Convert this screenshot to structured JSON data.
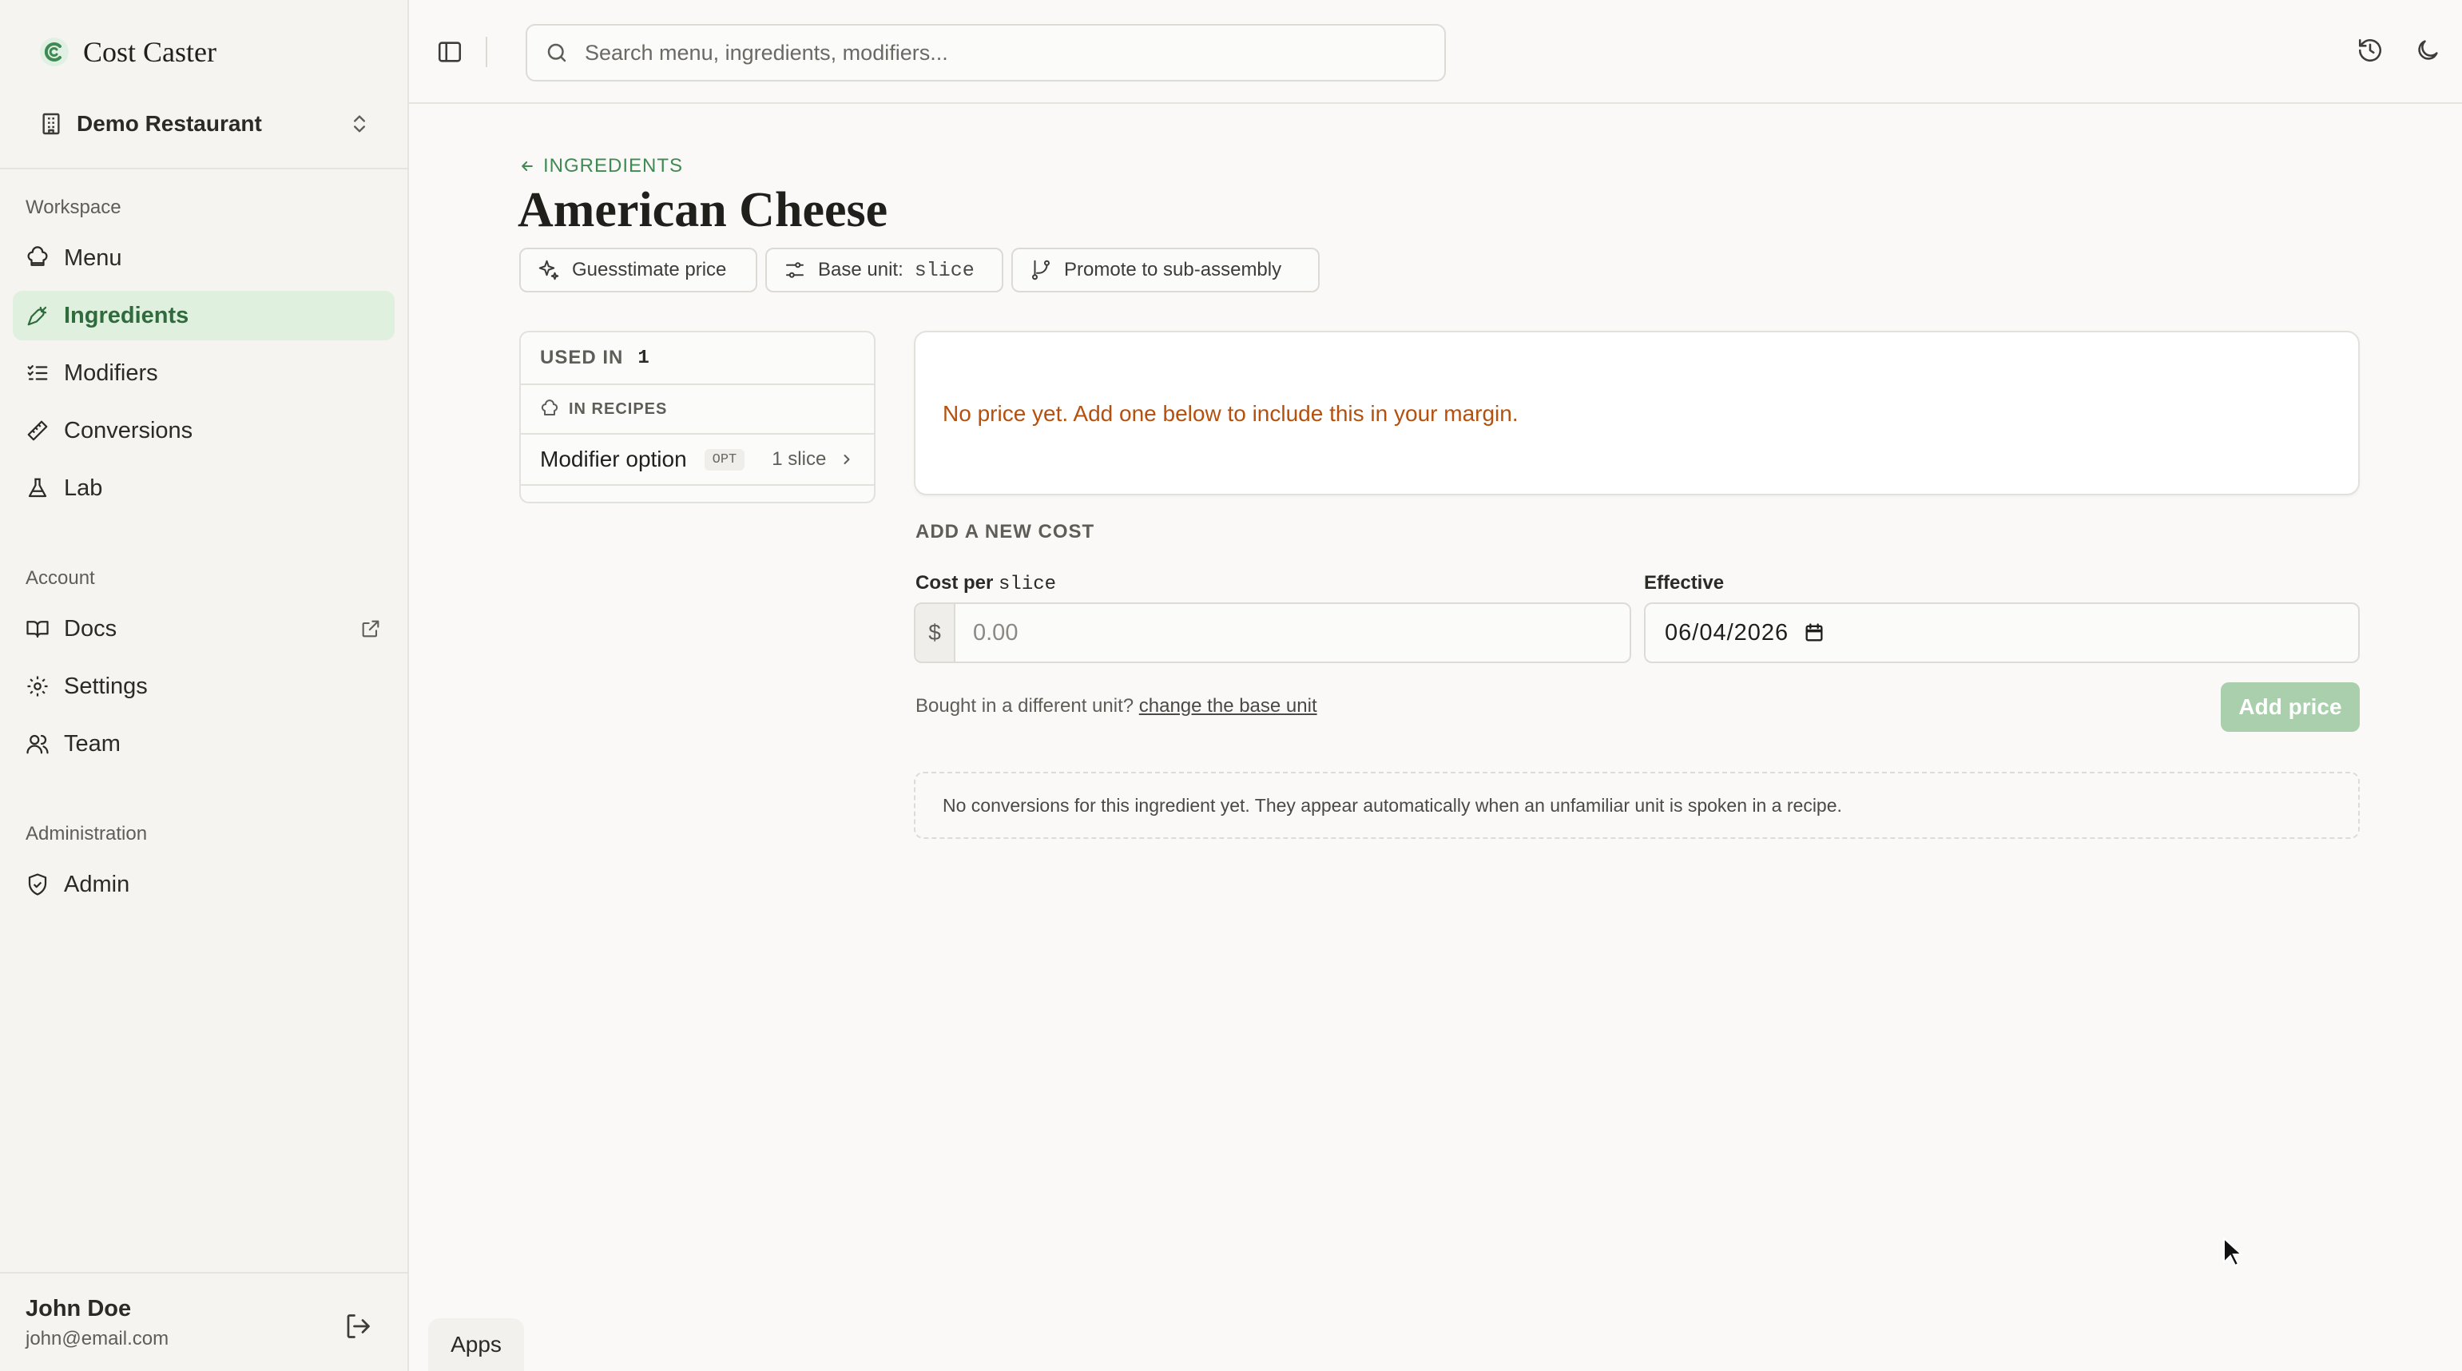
{
  "brand": {
    "name": "Cost Caster",
    "accent_color": "#3f8a52"
  },
  "restaurant": {
    "name": "Demo Restaurant"
  },
  "sidebar": {
    "workspace_label": "Workspace",
    "workspace_items": [
      {
        "label": "Menu",
        "icon": "chef-hat-icon"
      },
      {
        "label": "Ingredients",
        "icon": "carrot-icon",
        "active": true
      },
      {
        "label": "Modifiers",
        "icon": "list-checks-icon"
      },
      {
        "label": "Conversions",
        "icon": "ruler-icon"
      },
      {
        "label": "Lab",
        "icon": "flask-icon"
      }
    ],
    "account_label": "Account",
    "account_items": [
      {
        "label": "Docs",
        "icon": "book-icon"
      },
      {
        "label": "Settings",
        "icon": "gear-icon"
      },
      {
        "label": "Team",
        "icon": "users-icon"
      }
    ],
    "admin_label": "Administration",
    "admin_items": [
      {
        "label": "Admin",
        "icon": "shield-check-icon"
      }
    ]
  },
  "user": {
    "name": "John Doe",
    "email": "john@email.com"
  },
  "search": {
    "placeholder": "Search menu, ingredients, modifiers..."
  },
  "page": {
    "back_label": "INGREDIENTS",
    "title": "American Cheese",
    "actions": {
      "guesstimate": "Guesstimate price",
      "base_unit_label": "Base unit:",
      "base_unit_value": "slice",
      "promote": "Promote to sub-assembly"
    }
  },
  "used_in": {
    "label": "USED IN",
    "count": "1",
    "section_label": "IN RECIPES",
    "rows": [
      {
        "name": "Modifier option",
        "badge": "OPT",
        "qty": "1 slice"
      }
    ]
  },
  "price": {
    "empty_message": "No price yet. Add one below to include this in your margin.",
    "warning_color": "#b5500d"
  },
  "add_cost": {
    "heading": "ADD A NEW COST",
    "cost_label_prefix": "Cost per",
    "cost_label_unit": "slice",
    "currency": "$",
    "cost_placeholder": "0.00",
    "effective_label": "Effective",
    "effective_value": "06/04/2026",
    "alt_unit_text": "Bought in a different unit?",
    "alt_unit_link": "change the base unit",
    "submit_label": "Add price"
  },
  "conversions": {
    "empty_message": "No conversions for this ingredient yet. They appear automatically when an unfamiliar unit is spoken in a recipe."
  },
  "apps_tab": {
    "label": "Apps"
  }
}
